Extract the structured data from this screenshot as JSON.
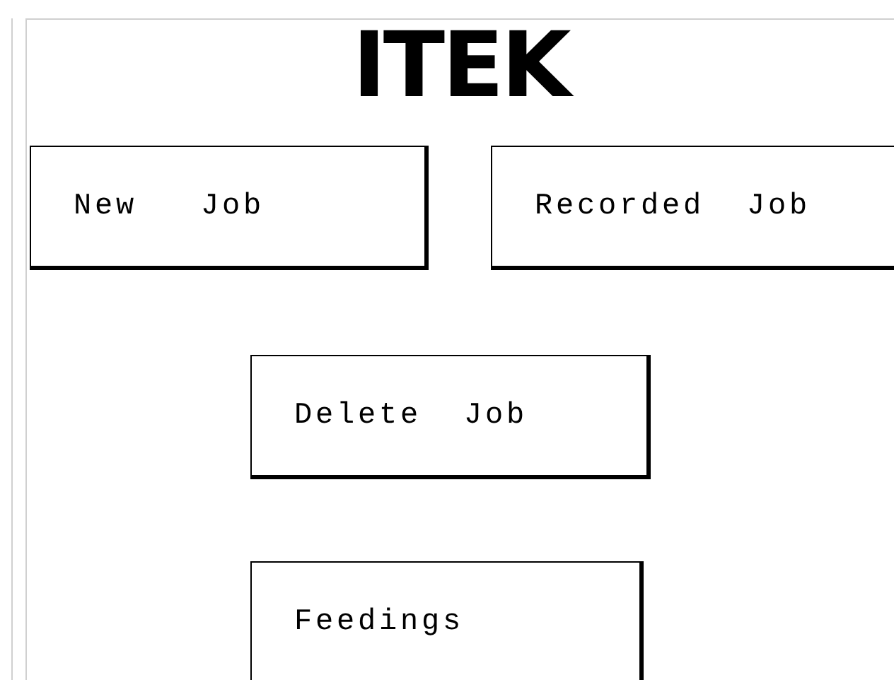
{
  "logo": "ITEK",
  "top_buttons": [
    "New   Job",
    "Recorded  Job"
  ],
  "center_buttons": [
    "Delete  Job",
    "Feedings"
  ]
}
